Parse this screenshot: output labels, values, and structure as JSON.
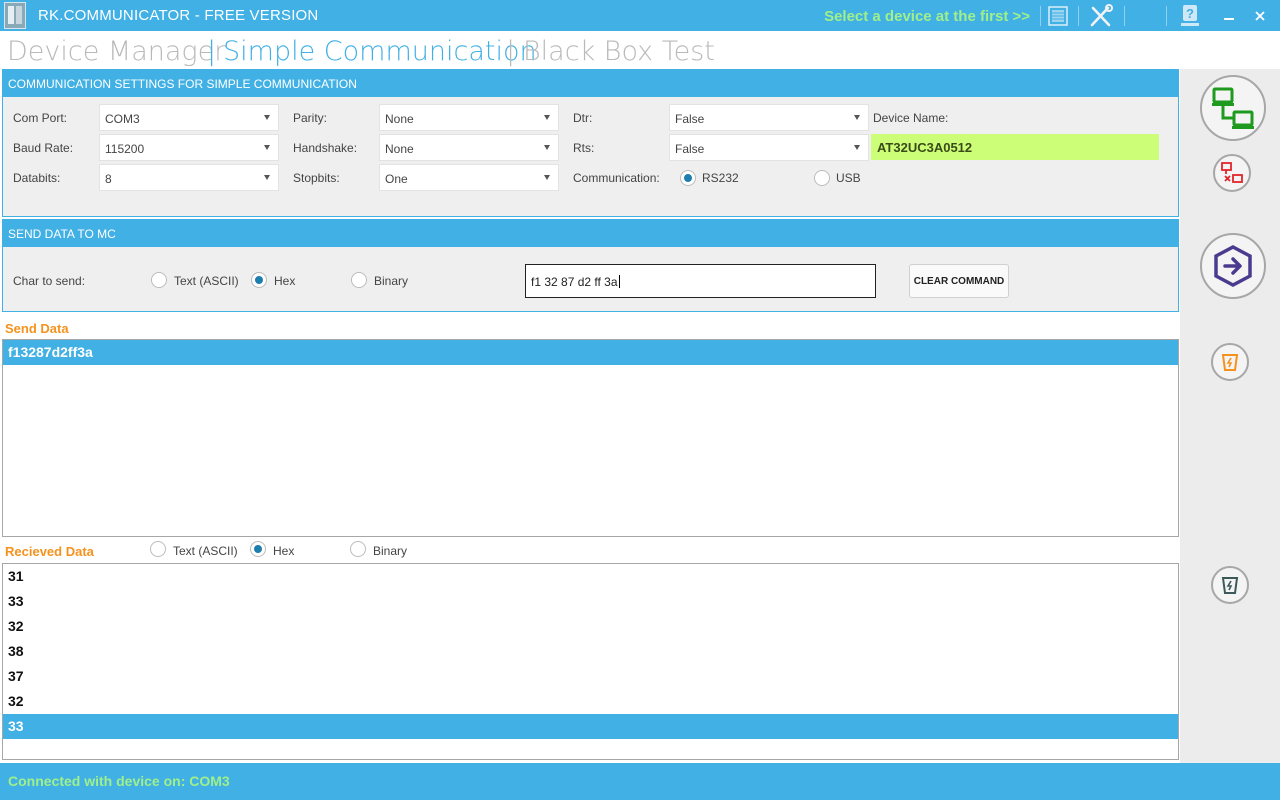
{
  "window": {
    "title": "RK.COMMUNICATOR - FREE VERSION",
    "hint": "Select a device at the first >>"
  },
  "nav": {
    "items": [
      "Device Manager",
      "Simple Communication",
      "Black Box Test"
    ],
    "separator": "|",
    "active": "Simple Communication"
  },
  "settings": {
    "header": "COMMUNICATION SETTINGS FOR SIMPLE COMMUNICATION",
    "com_port": {
      "label": "Com Port:",
      "value": "COM3"
    },
    "baud_rate": {
      "label": "Baud Rate:",
      "value": "115200"
    },
    "databits": {
      "label": "Databits:",
      "value": "8"
    },
    "parity": {
      "label": "Parity:",
      "value": "None"
    },
    "handshake": {
      "label": "Handshake:",
      "value": "None"
    },
    "stopbits": {
      "label": "Stopbits:",
      "value": "One"
    },
    "dtr": {
      "label": "Dtr:",
      "value": "False"
    },
    "rts": {
      "label": "Rts:",
      "value": "False"
    },
    "communication": {
      "label": "Communication:",
      "options": [
        "RS232",
        "USB"
      ],
      "selected": "RS232"
    },
    "device_name": {
      "label": "Device Name:",
      "value": "AT32UC3A0512"
    }
  },
  "send": {
    "header": "SEND DATA TO MC",
    "char_label": "Char to send:",
    "modes": [
      "Text (ASCII)",
      "Hex",
      "Binary"
    ],
    "selected_mode": "Hex",
    "command_value": "f1 32 87 d2 ff 3a",
    "clear_label": "CLEAR COMMAND"
  },
  "send_data": {
    "label": "Send Data",
    "rows": [
      "f13287d2ff3a"
    ],
    "selected_index": 0
  },
  "received": {
    "label": "Recieved Data",
    "modes": [
      "Text (ASCII)",
      "Hex",
      "Binary"
    ],
    "selected_mode": "Hex",
    "rows": [
      "31",
      "33",
      "32",
      "38",
      "37",
      "32",
      "33"
    ],
    "selected_index": 6
  },
  "status": {
    "text": "Connected with device on: COM3"
  },
  "colors": {
    "accent": "#41b0e4",
    "hint_green": "#9ff08b",
    "orange": "#f5921e",
    "device_name_bg": "#ccff77",
    "connect_green": "#1e9a1e",
    "disconnect_red": "#e0262b",
    "send_purple": "#4b3b8f"
  },
  "icons": {
    "connect": "network-connect-icon",
    "disconnect": "network-disconnect-icon",
    "send": "send-arrow-icon",
    "clear_send": "clear-send-bucket-icon",
    "clear_received": "clear-received-bucket-icon"
  }
}
